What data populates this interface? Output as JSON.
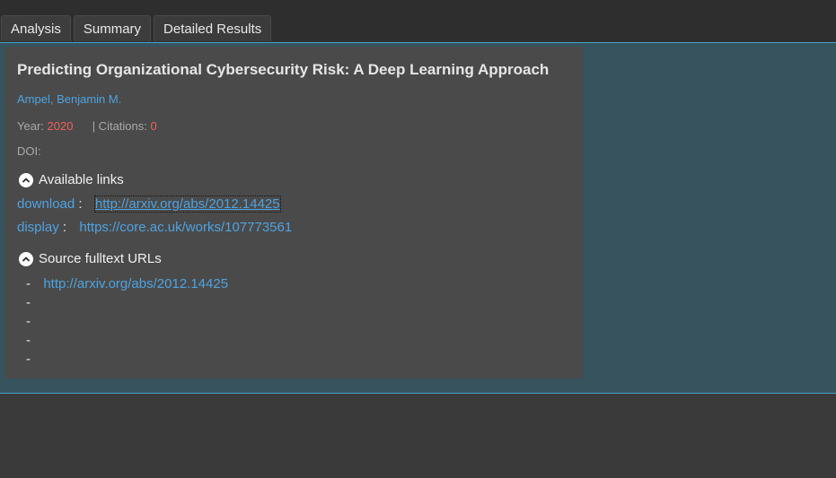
{
  "tabs": [
    {
      "label": "Analysis"
    },
    {
      "label": "Summary"
    },
    {
      "label": "Detailed Results"
    }
  ],
  "paper": {
    "title": "Predicting Organizational Cybersecurity Risk: A Deep Learning Approach",
    "author": "Ampel, Benjamin M.",
    "year_label": "Year:",
    "year": "2020",
    "citations_label": "| Citations:",
    "citations": "0",
    "doi_label": "DOI:"
  },
  "available_links": {
    "heading": "Available links",
    "links": [
      {
        "label": "download",
        "sep": ":",
        "url": "http://arxiv.org/abs/2012.14425"
      },
      {
        "label": "display",
        "sep": ":",
        "url": "https://core.ac.uk/works/107773561"
      }
    ]
  },
  "source_fulltext": {
    "heading": "Source fulltext URLs",
    "items": [
      "http://arxiv.org/abs/2012.14425",
      "",
      "",
      "",
      ""
    ],
    "bullet": "-"
  },
  "colors": {
    "accent": "#4aa3c9",
    "link": "#4fa3e0",
    "highlight": "#f0605a",
    "panel_bg": "#36535e",
    "card_bg": "#4a4a4a"
  }
}
